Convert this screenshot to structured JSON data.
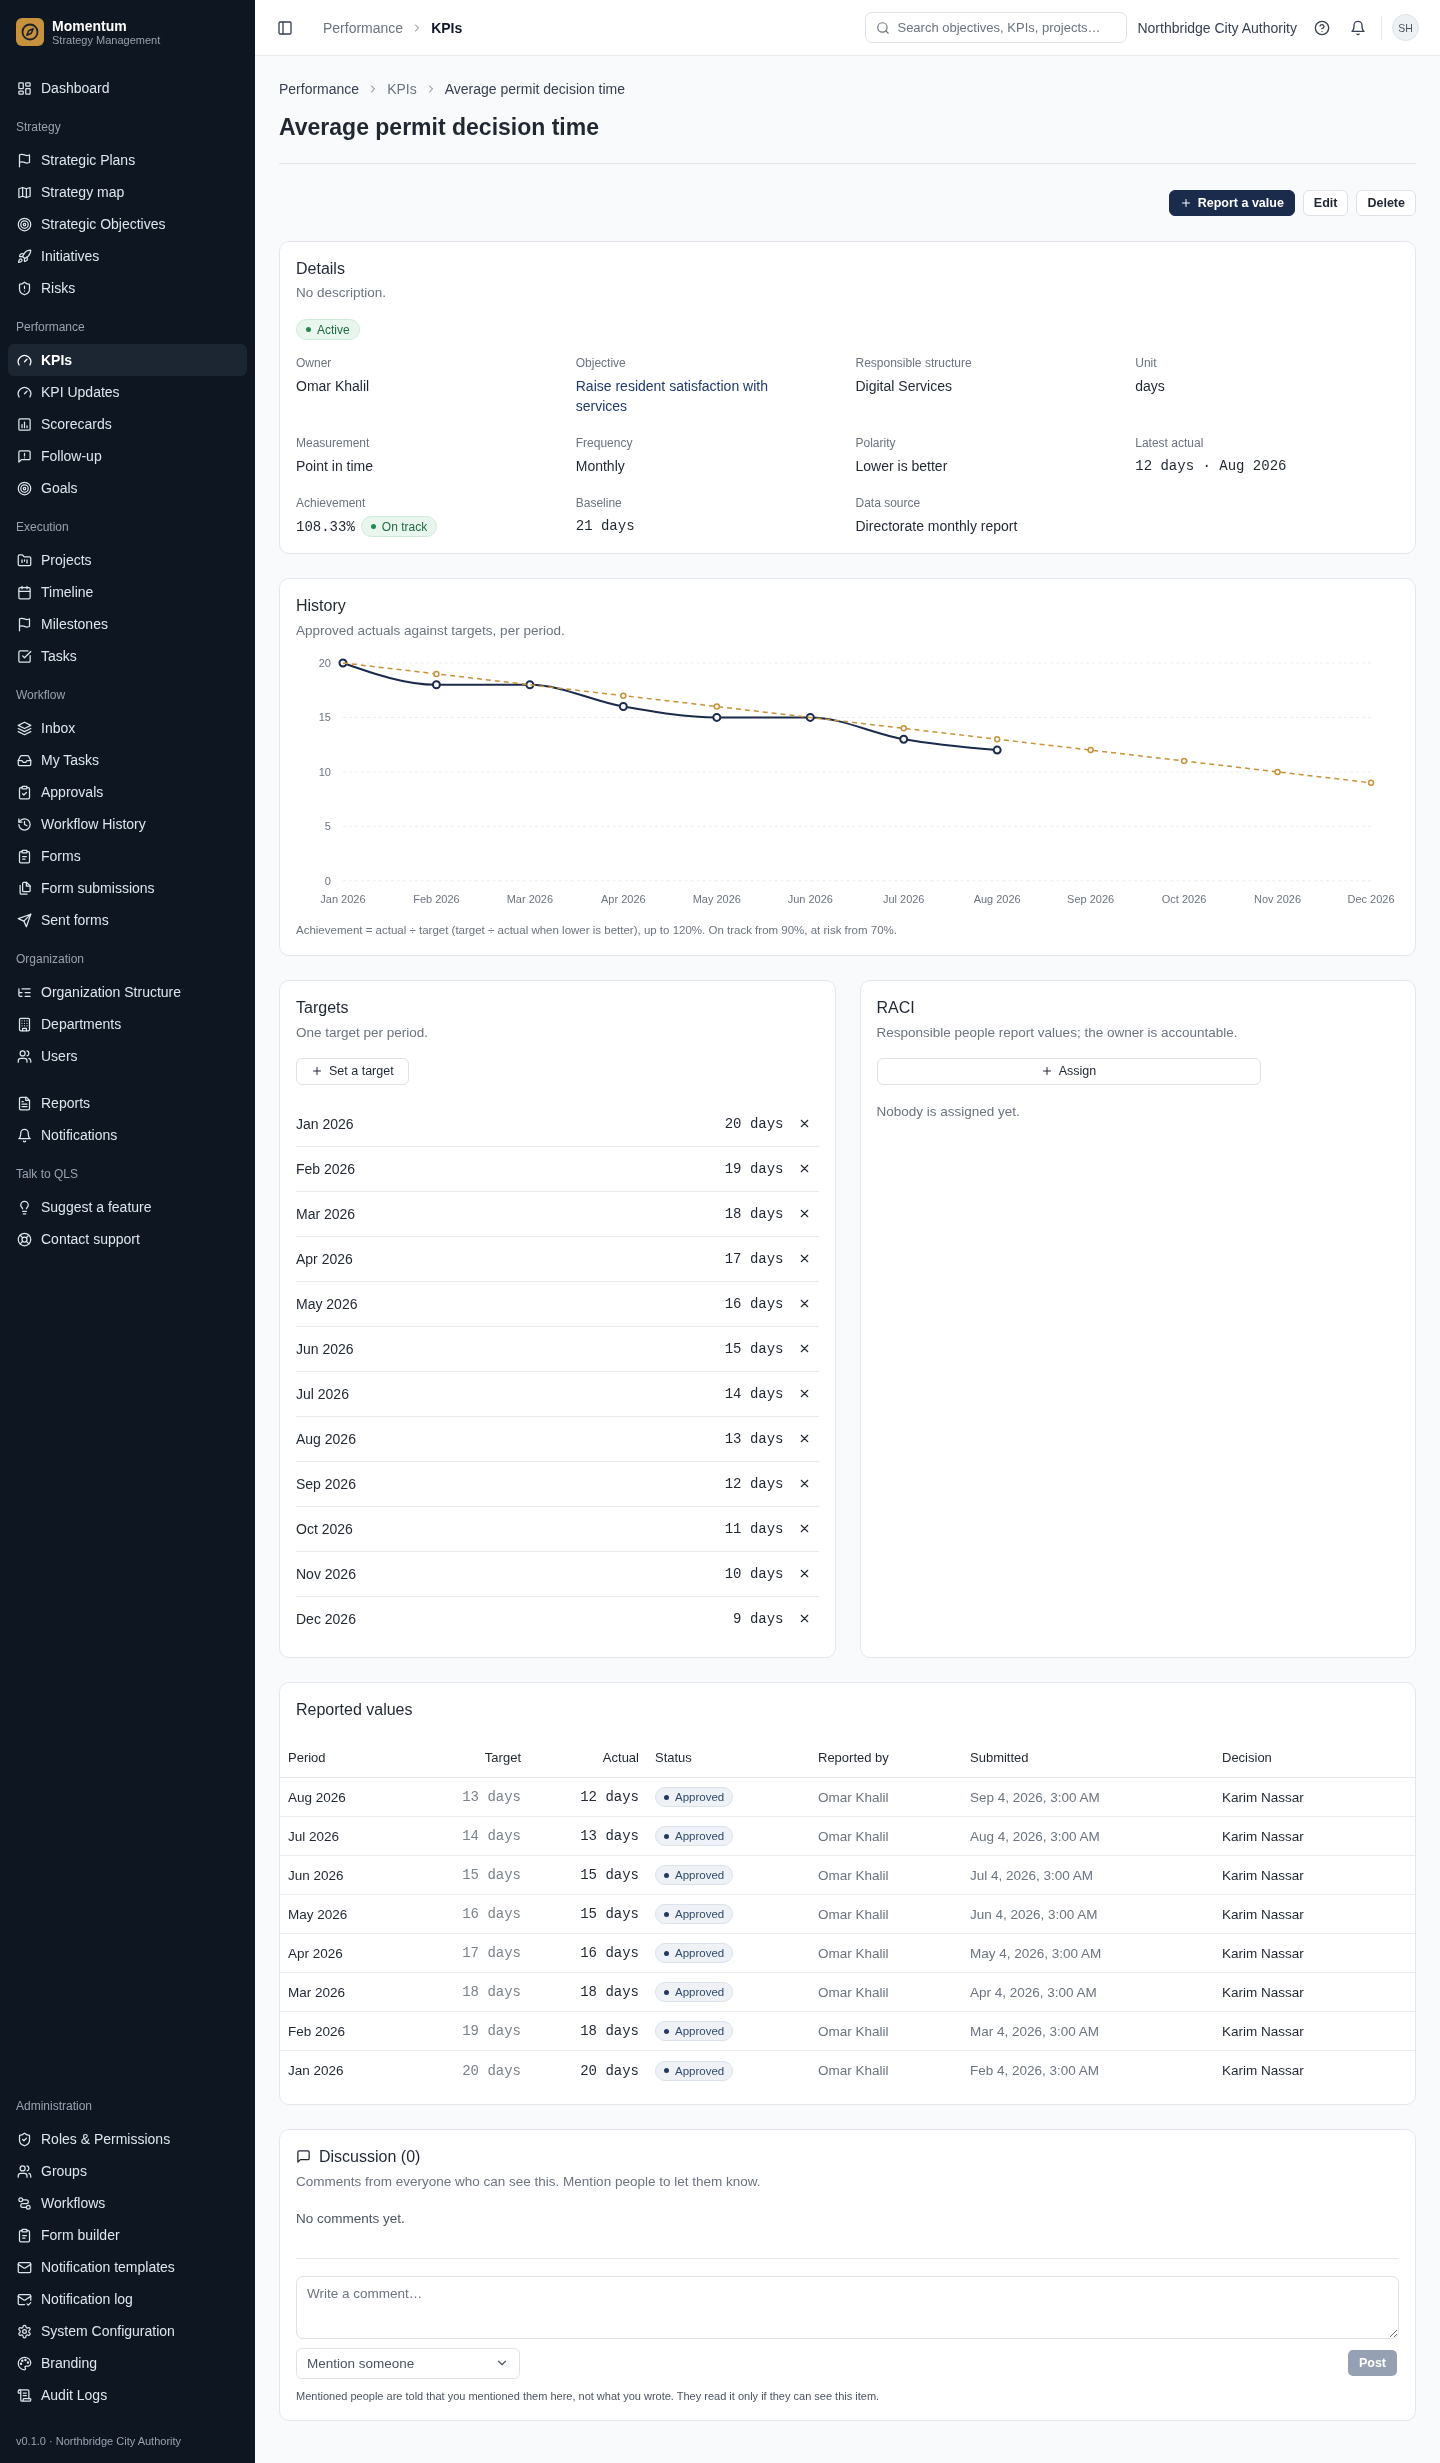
{
  "sidebar": {
    "brand": {
      "name": "Momentum",
      "tagline": "Strategy Management"
    },
    "sections": [
      {
        "items": [
          {
            "label": "Dashboard",
            "selected": false
          }
        ]
      },
      {
        "heading": "Strategy",
        "items": [
          {
            "label": "Strategic Plans",
            "selected": false
          },
          {
            "label": "Strategy map",
            "selected": false
          },
          {
            "label": "Strategic Objectives",
            "selected": false
          },
          {
            "label": "Initiatives",
            "selected": false
          },
          {
            "label": "Risks",
            "selected": false
          }
        ]
      },
      {
        "heading": "Performance",
        "items": [
          {
            "label": "KPIs",
            "selected": true
          },
          {
            "label": "KPI Updates",
            "selected": false
          },
          {
            "label": "Scorecards",
            "selected": false
          },
          {
            "label": "Follow-up",
            "selected": false
          },
          {
            "label": "Goals",
            "selected": false
          }
        ]
      },
      {
        "heading": "Execution",
        "items": [
          {
            "label": "Projects",
            "selected": false
          },
          {
            "label": "Timeline",
            "selected": false
          },
          {
            "label": "Milestones",
            "selected": false
          },
          {
            "label": "Tasks",
            "selected": false
          }
        ]
      },
      {
        "heading": "Workflow",
        "items": [
          {
            "label": "Inbox",
            "selected": false
          },
          {
            "label": "My Tasks",
            "selected": false
          },
          {
            "label": "Approvals",
            "selected": false
          },
          {
            "label": "Workflow History",
            "selected": false
          },
          {
            "label": "Forms",
            "selected": false
          },
          {
            "label": "Form submissions",
            "selected": false
          },
          {
            "label": "Sent forms",
            "selected": false
          }
        ]
      },
      {
        "heading": "Organization",
        "items": [
          {
            "label": "Organization Structure",
            "selected": false
          },
          {
            "label": "Departments",
            "selected": false
          },
          {
            "label": "Users",
            "selected": false
          }
        ]
      },
      {
        "items": [
          {
            "label": "Reports",
            "selected": false
          },
          {
            "label": "Notifications",
            "selected": false
          }
        ]
      },
      {
        "heading": "Talk to QLS",
        "items": [
          {
            "label": "Suggest a feature",
            "selected": false
          },
          {
            "label": "Contact support",
            "selected": false
          }
        ]
      }
    ],
    "bottom_section": {
      "heading": "Administration",
      "items": [
        {
          "label": "Roles & Permissions",
          "selected": false
        },
        {
          "label": "Groups",
          "selected": false
        },
        {
          "label": "Workflows",
          "selected": false
        },
        {
          "label": "Form builder",
          "selected": false
        },
        {
          "label": "Notification templates",
          "selected": false
        },
        {
          "label": "Notification log",
          "selected": false
        },
        {
          "label": "System Configuration",
          "selected": false
        },
        {
          "label": "Branding",
          "selected": false
        },
        {
          "label": "Audit Logs",
          "selected": false
        }
      ]
    },
    "footer": "v0.1.0 · Northbridge City Authority"
  },
  "header": {
    "breadcrumb": [
      "Performance",
      "KPIs"
    ],
    "search": {
      "placeholder": "Search objectives, KPIs, projects…"
    },
    "organization": "Northbridge City Authority",
    "avatar": "SH"
  },
  "page": {
    "breadcrumb": [
      "Performance",
      "KPIs",
      "Average permit decision time"
    ],
    "title": "Average permit decision time",
    "actions": [
      {
        "label": "Report a value",
        "kind": "primary"
      },
      {
        "label": "Edit",
        "kind": "secondary"
      },
      {
        "label": "Delete",
        "kind": "secondary"
      }
    ]
  },
  "details": {
    "title": "Details",
    "description": "No description.",
    "status": "Active",
    "fields": [
      {
        "label": "Owner",
        "value": "Omar Khalil",
        "kind": "text"
      },
      {
        "label": "Objective",
        "value": "Raise resident satisfaction with services",
        "kind": "link"
      },
      {
        "label": "Responsible structure",
        "value": "Digital Services",
        "kind": "text"
      },
      {
        "label": "Unit",
        "value": "days",
        "kind": "text"
      },
      {
        "label": "Measurement",
        "value": "Point in time",
        "kind": "text"
      },
      {
        "label": "Frequency",
        "value": "Monthly",
        "kind": "text"
      },
      {
        "label": "Polarity",
        "value": "Lower is better",
        "kind": "text"
      },
      {
        "label": "Latest actual",
        "value": "12 days · Aug 2026",
        "kind": "mono"
      },
      {
        "label": "Achievement",
        "value": "108.33%",
        "kind": "mono",
        "badge": "On track"
      },
      {
        "label": "Baseline",
        "value": "21 days",
        "kind": "mono"
      },
      {
        "label": "Data source",
        "value": "Directorate monthly report",
        "kind": "text"
      }
    ]
  },
  "history": {
    "title": "History",
    "subtitle": "Approved actuals against targets, per period.",
    "chart_data": {
      "type": "line",
      "categories": [
        "Jan 2026",
        "Feb 2026",
        "Mar 2026",
        "Apr 2026",
        "May 2026",
        "Jun 2026",
        "Jul 2026",
        "Aug 2026",
        "Sep 2026",
        "Oct 2026",
        "Nov 2026",
        "Dec 2026"
      ],
      "series": [
        {
          "color": "#1b2b4b",
          "line_style": "solid",
          "marker": "circle",
          "values": [
            20,
            18,
            18,
            16,
            15,
            15,
            13,
            12,
            null,
            null,
            null,
            null
          ]
        },
        {
          "color": "#c8923a",
          "line_style": "dashed",
          "marker": "small_circle",
          "values": [
            20,
            19,
            18,
            17,
            16,
            15,
            14,
            13,
            12,
            11,
            10,
            9
          ]
        }
      ],
      "ylim": [
        0,
        20
      ],
      "yticks": [
        0,
        5,
        10,
        15,
        20
      ],
      "grid": true
    },
    "footnote": "Achievement = actual ÷ target (target ÷ actual when lower is better), up to 120%. On track from 90%, at risk from 70%."
  },
  "targets": {
    "title": "Targets",
    "subtitle": "One target per period.",
    "add_button": "Set a target",
    "rows": [
      {
        "period": "Jan 2026",
        "value": "20 days"
      },
      {
        "period": "Feb 2026",
        "value": "19 days"
      },
      {
        "period": "Mar 2026",
        "value": "18 days"
      },
      {
        "period": "Apr 2026",
        "value": "17 days"
      },
      {
        "period": "May 2026",
        "value": "16 days"
      },
      {
        "period": "Jun 2026",
        "value": "15 days"
      },
      {
        "period": "Jul 2026",
        "value": "14 days"
      },
      {
        "period": "Aug 2026",
        "value": "13 days"
      },
      {
        "period": "Sep 2026",
        "value": "12 days"
      },
      {
        "period": "Oct 2026",
        "value": "11 days"
      },
      {
        "period": "Nov 2026",
        "value": "10 days"
      },
      {
        "period": "Dec 2026",
        "value": "9 days"
      }
    ]
  },
  "raci": {
    "title": "RACI",
    "subtitle": "Responsible people report values; the owner is accountable.",
    "assign_button": "Assign",
    "empty": "Nobody is assigned yet."
  },
  "reported_values": {
    "title": "Reported values",
    "columns": [
      "Period",
      "Target",
      "Actual",
      "Status",
      "Reported by",
      "Submitted",
      "Decision"
    ],
    "rows": [
      {
        "period": "Aug 2026",
        "target": "13 days",
        "actual": "12 days",
        "status": "Approved",
        "reported_by": "Omar Khalil",
        "submitted": "Sep 4, 2026, 3:00 AM",
        "decision": "Karim Nassar"
      },
      {
        "period": "Jul 2026",
        "target": "14 days",
        "actual": "13 days",
        "status": "Approved",
        "reported_by": "Omar Khalil",
        "submitted": "Aug 4, 2026, 3:00 AM",
        "decision": "Karim Nassar"
      },
      {
        "period": "Jun 2026",
        "target": "15 days",
        "actual": "15 days",
        "status": "Approved",
        "reported_by": "Omar Khalil",
        "submitted": "Jul 4, 2026, 3:00 AM",
        "decision": "Karim Nassar"
      },
      {
        "period": "May 2026",
        "target": "16 days",
        "actual": "15 days",
        "status": "Approved",
        "reported_by": "Omar Khalil",
        "submitted": "Jun 4, 2026, 3:00 AM",
        "decision": "Karim Nassar"
      },
      {
        "period": "Apr 2026",
        "target": "17 days",
        "actual": "16 days",
        "status": "Approved",
        "reported_by": "Omar Khalil",
        "submitted": "May 4, 2026, 3:00 AM",
        "decision": "Karim Nassar"
      },
      {
        "period": "Mar 2026",
        "target": "18 days",
        "actual": "18 days",
        "status": "Approved",
        "reported_by": "Omar Khalil",
        "submitted": "Apr 4, 2026, 3:00 AM",
        "decision": "Karim Nassar"
      },
      {
        "period": "Feb 2026",
        "target": "19 days",
        "actual": "18 days",
        "status": "Approved",
        "reported_by": "Omar Khalil",
        "submitted": "Mar 4, 2026, 3:00 AM",
        "decision": "Karim Nassar"
      },
      {
        "period": "Jan 2026",
        "target": "20 days",
        "actual": "20 days",
        "status": "Approved",
        "reported_by": "Omar Khalil",
        "submitted": "Feb 4, 2026, 3:00 AM",
        "decision": "Karim Nassar"
      }
    ]
  },
  "discussion": {
    "title": "Discussion (0)",
    "subtitle": "Comments from everyone who can see this. Mention people to let them know.",
    "empty": "No comments yet.",
    "comment": {
      "placeholder": "Write a comment…"
    },
    "mention": "Mention someone",
    "post_button": {
      "label": "Post",
      "disabled": true
    },
    "note": "Mentioned people are told that you mentioned them here, not what you wrote. They read it only if they can see this item."
  }
}
